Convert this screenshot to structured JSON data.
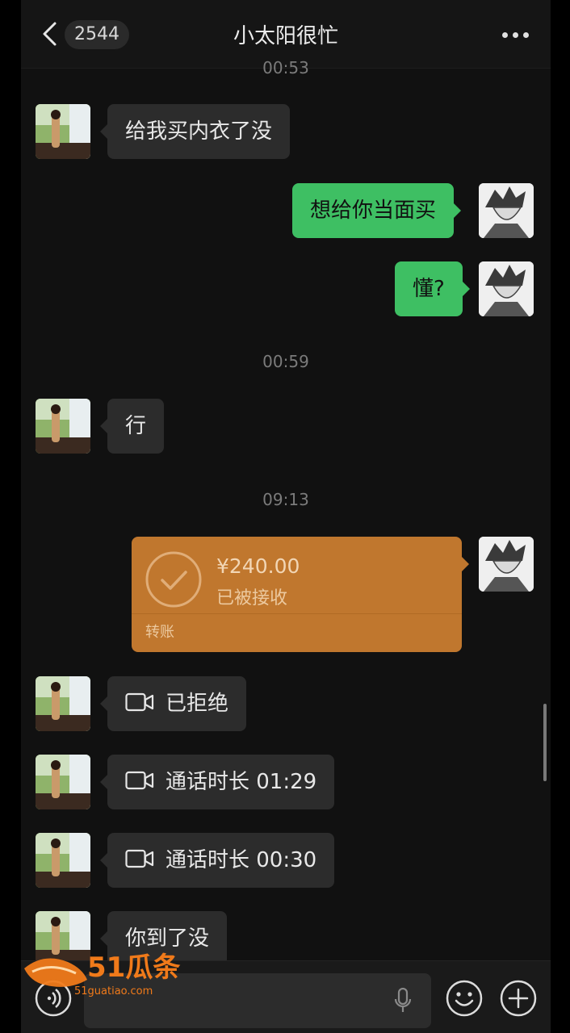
{
  "header": {
    "back_icon": "chevron-left-icon",
    "unread_count": "2544",
    "title": "小太阳很忙",
    "more_icon": "more-horizontal-icon"
  },
  "timestamps": [
    "00:53",
    "00:59",
    "09:13"
  ],
  "messages": [
    {
      "side": "in",
      "text": "给我买内衣了没"
    },
    {
      "side": "out",
      "text": "想给你当面买"
    },
    {
      "side": "out",
      "text": "懂?"
    },
    {
      "side": "in",
      "text": "行"
    },
    {
      "side": "out",
      "type": "transfer",
      "amount": "¥240.00",
      "status": "已被接收",
      "label": "转账"
    },
    {
      "side": "in",
      "type": "video-call",
      "text": "已拒绝"
    },
    {
      "side": "in",
      "type": "video-call",
      "text": "通话时长 01:29"
    },
    {
      "side": "in",
      "type": "video-call",
      "text": "通话时长 00:30"
    },
    {
      "side": "in",
      "text": "你到了没"
    }
  ],
  "footer": {
    "voice_icon": "voice-input-icon",
    "mic_icon": "microphone-icon",
    "emoji_icon": "emoji-icon",
    "plus_icon": "plus-icon"
  },
  "watermark": {
    "brand": "51瓜条",
    "url": "51guatiao.com"
  },
  "colors": {
    "out_bubble": "#3ebf63",
    "in_bubble": "#2c2c2c",
    "transfer": "#c0772e",
    "background": "#111111"
  }
}
